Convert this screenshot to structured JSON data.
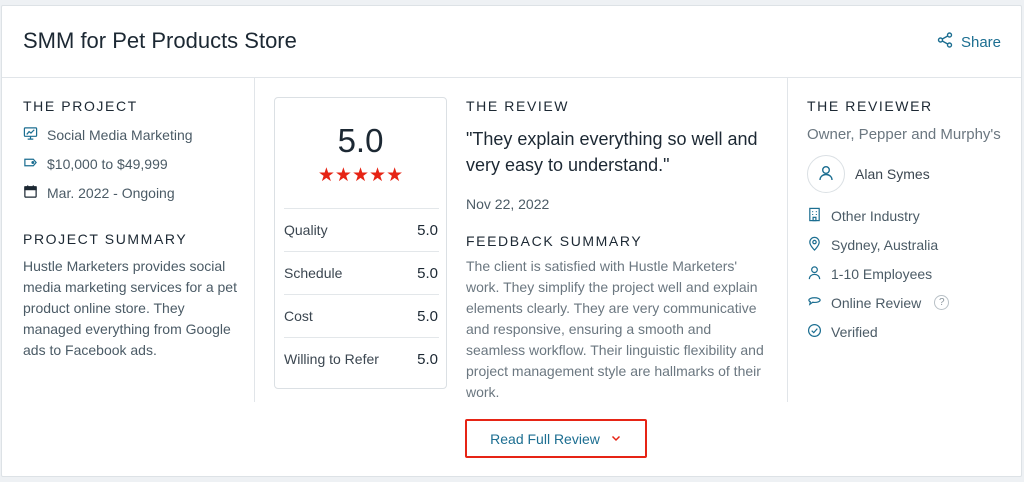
{
  "header": {
    "title": "SMM for Pet Products Store",
    "share_label": "Share"
  },
  "project": {
    "heading": "THE PROJECT",
    "items": [
      {
        "icon": "monitor-chart-icon",
        "text": "Social Media Marketing"
      },
      {
        "icon": "price-tag-icon",
        "text": "$10,000 to $49,999"
      },
      {
        "icon": "calendar-icon",
        "text": "Mar. 2022 - Ongoing"
      }
    ],
    "summary_heading": "PROJECT SUMMARY",
    "summary": "Hustle Marketers provides social media marketing services for a pet product online store. They managed everything from Google ads to Facebook ads."
  },
  "rating": {
    "overall": "5.0",
    "stars": 5,
    "rows": [
      {
        "label": "Quality",
        "value": "5.0"
      },
      {
        "label": "Schedule",
        "value": "5.0"
      },
      {
        "label": "Cost",
        "value": "5.0"
      },
      {
        "label": "Willing to Refer",
        "value": "5.0"
      }
    ]
  },
  "review": {
    "heading": "THE REVIEW",
    "quote": "\"They explain everything so well and very easy to understand.\"",
    "date": "Nov 22, 2022",
    "feedback_heading": "FEEDBACK SUMMARY",
    "feedback": "The client is satisfied with Hustle Marketers' work. They simplify the project well and explain elements clearly. They are very communicative and responsive, ensuring a smooth and seamless workflow. Their linguistic flexibility and project management style are hallmarks of their work."
  },
  "reviewer": {
    "heading": "THE REVIEWER",
    "title": "Owner, Pepper and Murphy's",
    "name": "Alan Symes",
    "items": [
      {
        "icon": "building-icon",
        "text": "Other Industry"
      },
      {
        "icon": "location-pin-icon",
        "text": "Sydney, Australia"
      },
      {
        "icon": "person-icon",
        "text": "1-10 Employees"
      },
      {
        "icon": "chat-bubble-icon",
        "text": "Online Review"
      },
      {
        "icon": "check-circle-icon",
        "text": "Verified"
      }
    ],
    "help_glyph": "?"
  },
  "footer": {
    "read_full_review_label": "Read Full Review"
  },
  "colors": {
    "accent_red": "#e62415",
    "link_blue": "#1c6e91",
    "heading": "#1c2833"
  }
}
